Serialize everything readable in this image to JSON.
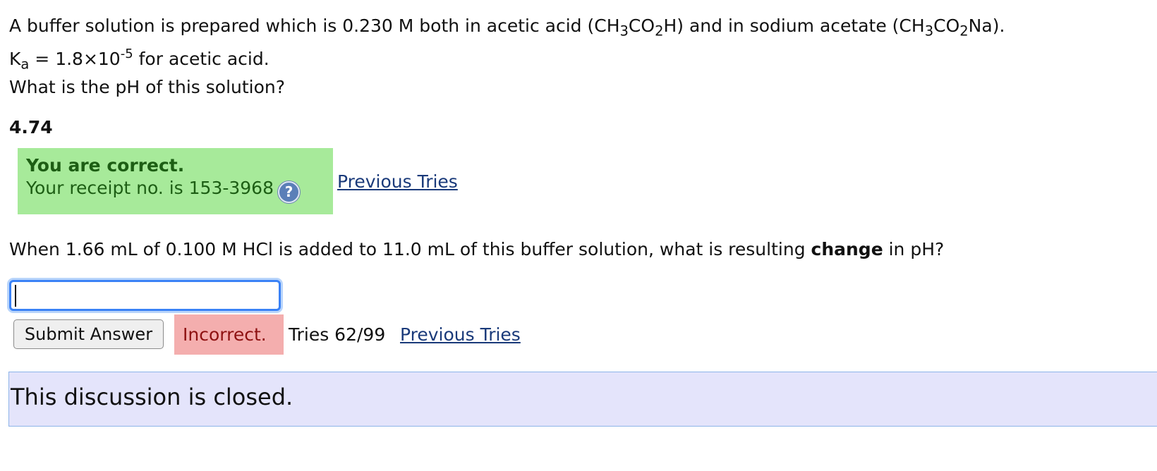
{
  "question1": {
    "line1_a": "A buffer solution is prepared which is 0.230 M both in acetic acid (CH",
    "line1_sub1": "3",
    "line1_b": "CO",
    "line1_sub2": "2",
    "line1_c": "H) and in sodium acetate (CH",
    "line1_sub3": "3",
    "line1_d": "CO",
    "line1_sub4": "2",
    "line1_e": "Na).",
    "ka_symbol": "K",
    "ka_sub": "a",
    "ka_value": " = 1.8×10",
    "ka_exp": "-5",
    "ka_rest": " for acetic acid.",
    "prompt": "What is the pH of this solution?"
  },
  "answer1": {
    "value": "4.74",
    "status_title": "You are correct.",
    "receipt": "Your receipt no. is 153-3968",
    "help_icon": "?",
    "previous_tries": "Previous Tries"
  },
  "question2": {
    "text_a": "When 1.66 mL of 0.100 M HCl is added to 11.0 mL of this buffer solution, what is resulting ",
    "text_bold": "change",
    "text_b": " in pH?"
  },
  "answer2": {
    "input_value": "",
    "submit_label": "Submit Answer",
    "status": "Incorrect.",
    "tries": "Tries 62/99",
    "previous_tries": "Previous Tries"
  },
  "discussion": {
    "closed_text": "This discussion is closed."
  },
  "colors": {
    "correct_bg": "#a7ea9a",
    "incorrect_bg": "#f4aeae",
    "link": "#1a3a7a",
    "discussion_bg": "#e4e4fb"
  }
}
